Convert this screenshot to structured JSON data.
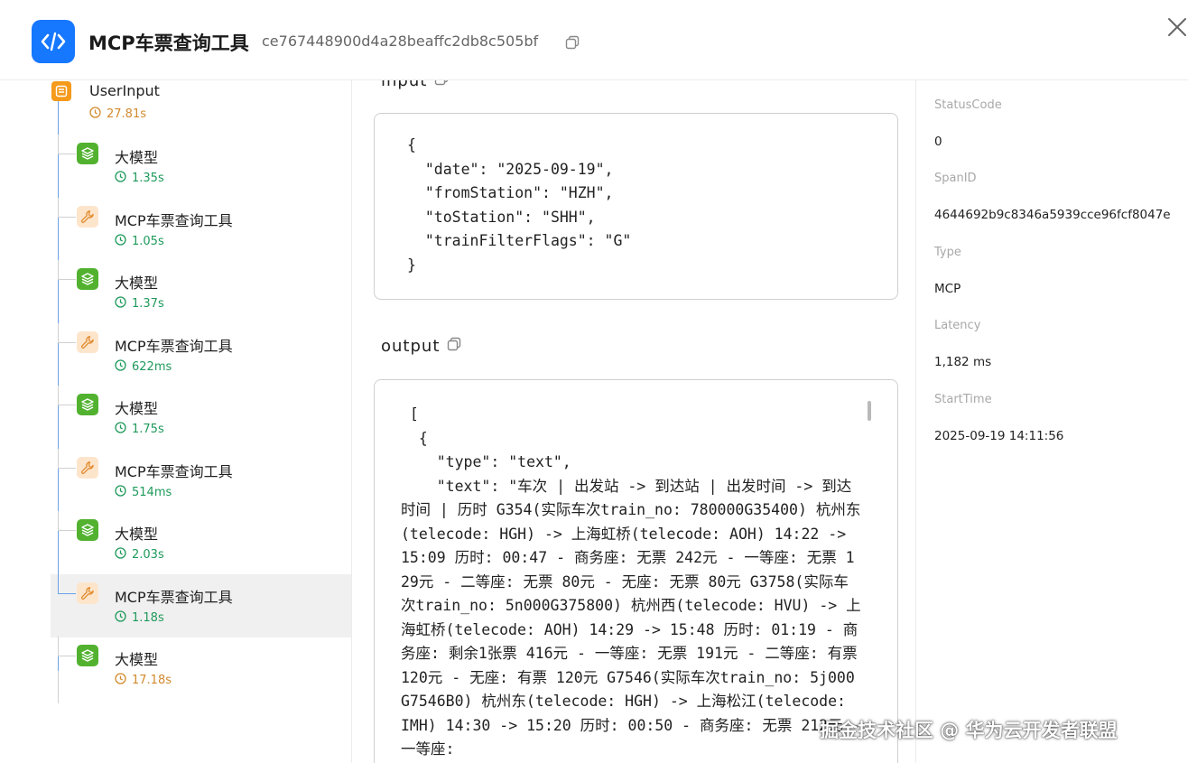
{
  "header": {
    "title": "MCP车票查询工具",
    "trace_id": "ce767448900d4a28beaffc2db8c505bf",
    "accent_color": "#1677ff"
  },
  "tree": {
    "root": {
      "name": "UserInput",
      "time": "27.81s"
    },
    "nodes": [
      {
        "name": "大模型",
        "type": "llm",
        "time": "1.35s"
      },
      {
        "name": "MCP车票查询工具",
        "type": "tool",
        "time": "1.05s"
      },
      {
        "name": "大模型",
        "type": "llm",
        "time": "1.37s"
      },
      {
        "name": "MCP车票查询工具",
        "type": "tool",
        "time": "622ms"
      },
      {
        "name": "大模型",
        "type": "llm",
        "time": "1.75s"
      },
      {
        "name": "MCP车票查询工具",
        "type": "tool",
        "time": "514ms"
      },
      {
        "name": "大模型",
        "type": "llm",
        "time": "2.03s"
      },
      {
        "name": "MCP车票查询工具",
        "type": "tool",
        "time": "1.18s",
        "selected": true
      },
      {
        "name": "大模型",
        "type": "llm",
        "time": "17.18s"
      }
    ]
  },
  "detail": {
    "input_label": "input",
    "input_json": "{\n  \"date\": \"2025-09-19\",\n  \"fromStation\": \"HZH\",\n  \"toStation\": \"SHH\",\n  \"trainFilterFlags\": \"G\"\n}",
    "output_label": "output",
    "output_head": " [\n  {\n    \"type\": \"text\",",
    "output_text": "    \"text\": \"车次 | 出发站 -> 到达站 | 出发时间 -> 到达时间 | 历时 G354(实际车次train_no: 780000G35400) 杭州东(telecode: HGH) -> 上海虹桥(telecode: AOH) 14:22 -> 15:09 历时: 00:47 - 商务座: 无票 242元 - 一等座: 无票 129元 - 二等座: 无票 80元 - 无座: 无票 80元 G3758(实际车次train_no: 5n000G375800) 杭州西(telecode: HVU) -> 上海虹桥(telecode: AOH) 14:29 -> 15:48 历时: 01:19 - 商务座: 剩余1张票 416元 - 一等座: 无票 191元 - 二等座: 有票 120元 - 无座: 有票 120元 G7546(实际车次train_no: 5j000G7546B0) 杭州东(telecode: HGH) -> 上海松江(telecode: IMH) 14:30 -> 15:20 历时: 00:50 - 商务座: 无票 212元 - 一等座:"
  },
  "attributes": [
    {
      "label": "StatusCode",
      "value": "0"
    },
    {
      "label": "SpanID",
      "value": "4644692b9c8346a5939cce96fcf8047e"
    },
    {
      "label": "Type",
      "value": "MCP"
    },
    {
      "label": "Latency",
      "value": "1,182 ms"
    },
    {
      "label": "StartTime",
      "value": "2025-09-19 14:11:56"
    }
  ],
  "watermark": "掘金技术社区 @ 华为云开发者联盟"
}
